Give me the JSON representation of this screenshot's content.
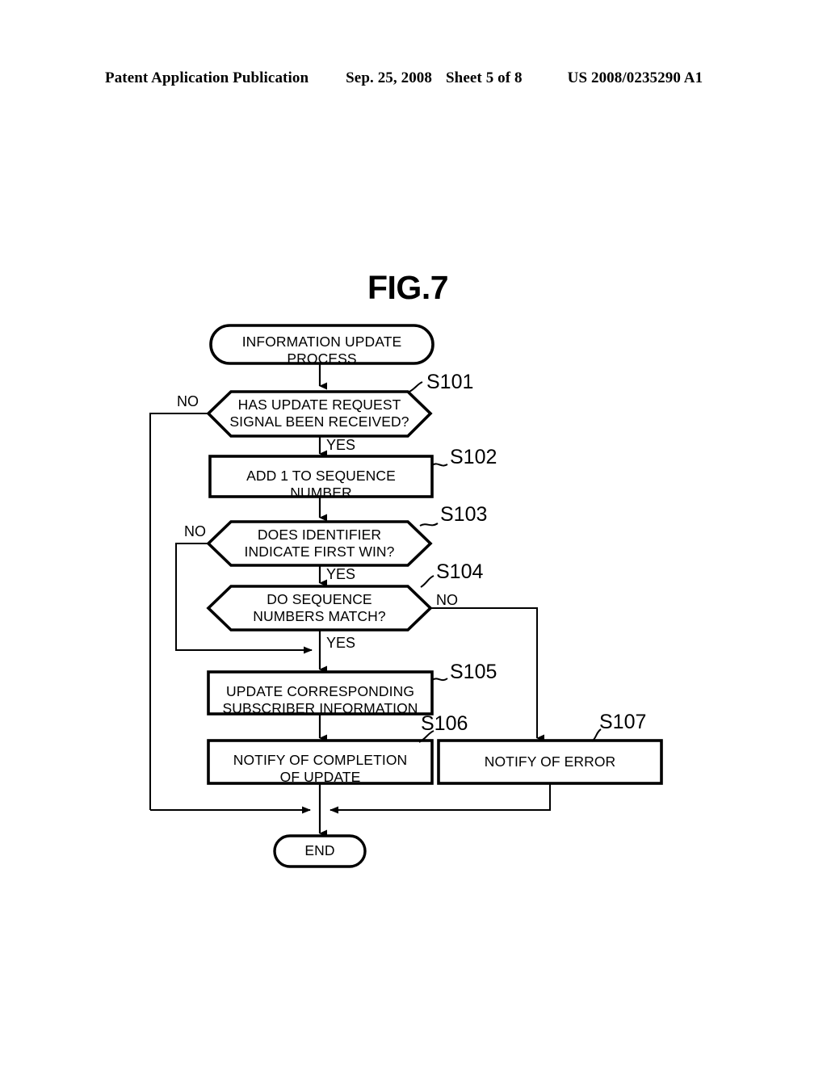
{
  "header": {
    "publication": "Patent Application Publication",
    "date": "Sep. 25, 2008",
    "sheet": "Sheet 5 of 8",
    "publication_number": "US 2008/0235290 A1"
  },
  "figure": {
    "title": "FIG.7",
    "nodes": {
      "start": "INFORMATION UPDATE\nPROCESS",
      "s101": "HAS UPDATE REQUEST\nSIGNAL BEEN RECEIVED?",
      "s102": "ADD 1 TO SEQUENCE\nNUMBER",
      "s103": "DOES IDENTIFIER\nINDICATE FIRST WIN?",
      "s104": "DO SEQUENCE\nNUMBERS MATCH?",
      "s105": "UPDATE CORRESPONDING\nSUBSCRIBER INFORMATION",
      "s106": "NOTIFY OF COMPLETION\nOF UPDATE",
      "s107": "NOTIFY OF ERROR",
      "end": "END"
    },
    "refs": {
      "s101": "S101",
      "s102": "S102",
      "s103": "S103",
      "s104": "S104",
      "s105": "S105",
      "s106": "S106",
      "s107": "S107"
    },
    "edge_labels": {
      "s101_no": "NO",
      "s101_yes": "YES",
      "s103_no": "NO",
      "s103_yes": "YES",
      "s104_no": "NO",
      "s104_yes": "YES"
    }
  }
}
